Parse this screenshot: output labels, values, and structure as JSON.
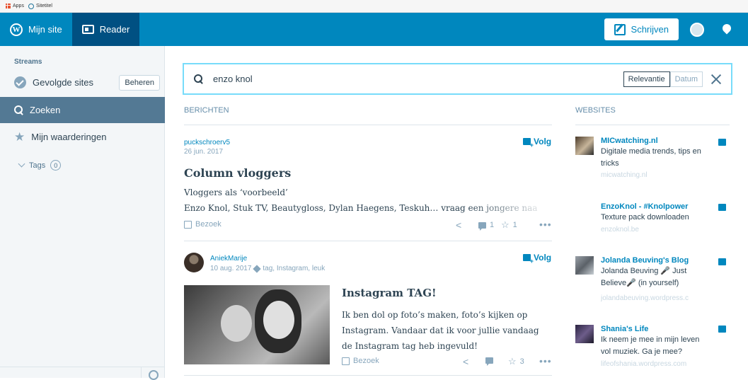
{
  "bookmarks": {
    "apps": "Apps",
    "sitetitel": "Sitetitel"
  },
  "masterbar": {
    "my_site": "Mijn site",
    "reader": "Reader",
    "write": "Schrijven"
  },
  "sidebar": {
    "heading": "Streams",
    "followed_sites": "Gevolgde sites",
    "manage": "Beheren",
    "search": "Zoeken",
    "likes": "Mijn waarderingen",
    "tags_label": "Tags",
    "tags_count": "0"
  },
  "search": {
    "value": "enzo knol",
    "sort_options": [
      "Relevantie",
      "Datum"
    ],
    "selected_sort": "Relevantie"
  },
  "posts_heading": "BERICHTEN",
  "sites_heading": "WEBSITES",
  "posts": [
    {
      "site": "puckschroerv5",
      "date": "26 jun. 2017",
      "follow": "Volg",
      "title": "Column vloggers",
      "line1": "Vloggers als ‘voorbeeld’",
      "line2": "Enzo Knol, Stuk TV, Beautygloss, Dylan Haegens, Teskuh… vraag een jongere naa",
      "visit": "Bezoek",
      "comments": "1",
      "likes": "1"
    },
    {
      "site": "AniekMarije",
      "date": "10 aug. 2017",
      "tags": "tag, Instagram, leuk",
      "follow": "Volg",
      "title": "Instagram TAG!",
      "text": [
        "Ik ben dol op foto’s maken, foto’s kijken op",
        "Instagram. Vandaar dat ik voor jullie vandaag",
        "de Instagram tag heb ingevuld!"
      ],
      "visit": "Bezoek",
      "likes": "3"
    }
  ],
  "websites": [
    {
      "name": "MICwatching.nl",
      "desc": "Digitale media trends, tips en tricks",
      "url": "micwatching.nl"
    },
    {
      "name": "EnzoKnol - #Knolpower",
      "desc": "Texture pack downloaden",
      "url": "enzoknol.be"
    },
    {
      "name": "Jolanda Beuving's Blog",
      "desc": "Jolanda Beuving 🎤 Just Believe🎤 (in yourself)",
      "url": "jolandabeuving.wordpress.c"
    },
    {
      "name": "Shania's Life",
      "desc": "Ik neem je mee in mijn leven vol muziek. Ga je mee?",
      "url": "lifeofshania.wordpress.com"
    }
  ]
}
